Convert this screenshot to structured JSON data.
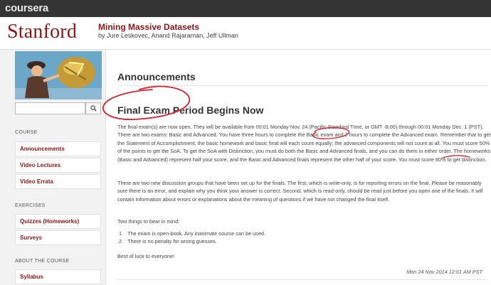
{
  "topbar": {
    "brand": "coursera"
  },
  "header": {
    "university": "Stanford",
    "course_title": "Mining Massive Datasets",
    "instructors": "by Jure Leskovec, Anand Rajaraman, Jeff Ullman"
  },
  "sidebar": {
    "search_placeholder": "",
    "sections": [
      {
        "title": "COURSE",
        "items": [
          "Announcements",
          "Video Lectures",
          "Video Errata"
        ]
      },
      {
        "title": "EXERCISES",
        "items": [
          "Quizzes (Homeworks)",
          "Surveys"
        ]
      },
      {
        "title": "ABOUT THE COURSE",
        "items": [
          "Syllabus"
        ]
      }
    ]
  },
  "main": {
    "page_title": "Announcements",
    "announcement": {
      "title": "Final Exam Period Begins Now",
      "para1": "The final exam(s) are now open. They will be available from 00:01 Monday Nov. 24 (Pacific Standard TIme, or GMT -8:00) through 00:01 Monday Dec. 1 (PST). There are two exams: Basic and Advanced. You have three hours to complete the Basic exam and 2 hours to complete the Advanced exam. Remember that to get the Statement of Accomplishment, the basic homework and basic final will each count equally; the advanced components will not count at all. You must score 50% of the points to get the SoA. To get the SoA with Distinction, you must do both the Basic and Advanced finals, and you can do them in either order. The homeworks (Basic and Advanced) represent half your score, and the Basic and Advanced finals represent the other half of your score. You must score 80% to get distinction.",
      "para2": "There are two new discussion groups that have been set up for the finals. The first, which is write-only, is for reporting errors on the final. Please be reasonably sure there is an error, and explain why you think your answer is correct. Second, which is read-only, should be read just before you open one of the finals. It will contain information about errors or explanations about the meaning of questions if we have not changed the final itself.",
      "para3": "Two things to bear in mind:",
      "list": [
        "The exam is open-book. Any inanimate source can be used.",
        "There is no penalty for wrong guesses."
      ],
      "list_numbers": [
        "1.",
        "2."
      ],
      "closing": "Best of luck to everyone!",
      "timestamp": "Mon 24 Nov 2014 12:01 AM PST"
    }
  },
  "colors": {
    "brand": "#8c1515",
    "topbar": "#353535",
    "annotation": "#d8242a"
  }
}
